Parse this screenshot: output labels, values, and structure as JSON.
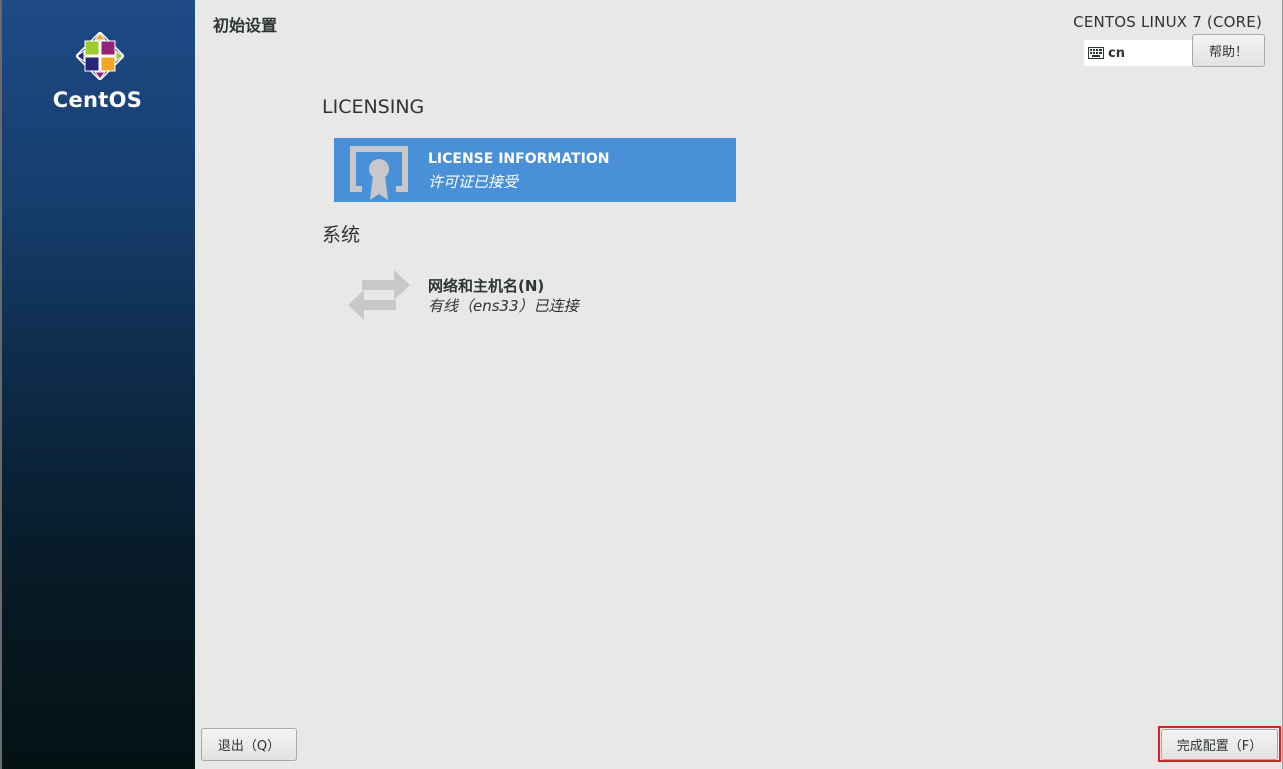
{
  "sidebar": {
    "brand": "CentOS",
    "logo_icon": "centos-logo-icon"
  },
  "header": {
    "title": "初始设置",
    "product": "CENTOS LINUX 7 (CORE)",
    "keyboard_layout": "cn",
    "keyboard_icon": "keyboard-icon",
    "help_label": "帮助！"
  },
  "sections": {
    "licensing": {
      "title": "LICENSING",
      "spoke": {
        "title": "LICENSE INFORMATION",
        "status": "许可证已接受",
        "icon": "license-certificate-icon"
      }
    },
    "system": {
      "title": "系统",
      "spoke": {
        "title": "网络和主机名(N)",
        "status": "有线（ens33）已连接",
        "icon": "network-arrows-icon"
      }
    }
  },
  "footer": {
    "quit_label": "退出（Q）",
    "finish_label": "完成配置（F）"
  },
  "colors": {
    "accent": "#4a90d9",
    "highlight_outline": "#e02020",
    "background": "#e8e8e7"
  }
}
